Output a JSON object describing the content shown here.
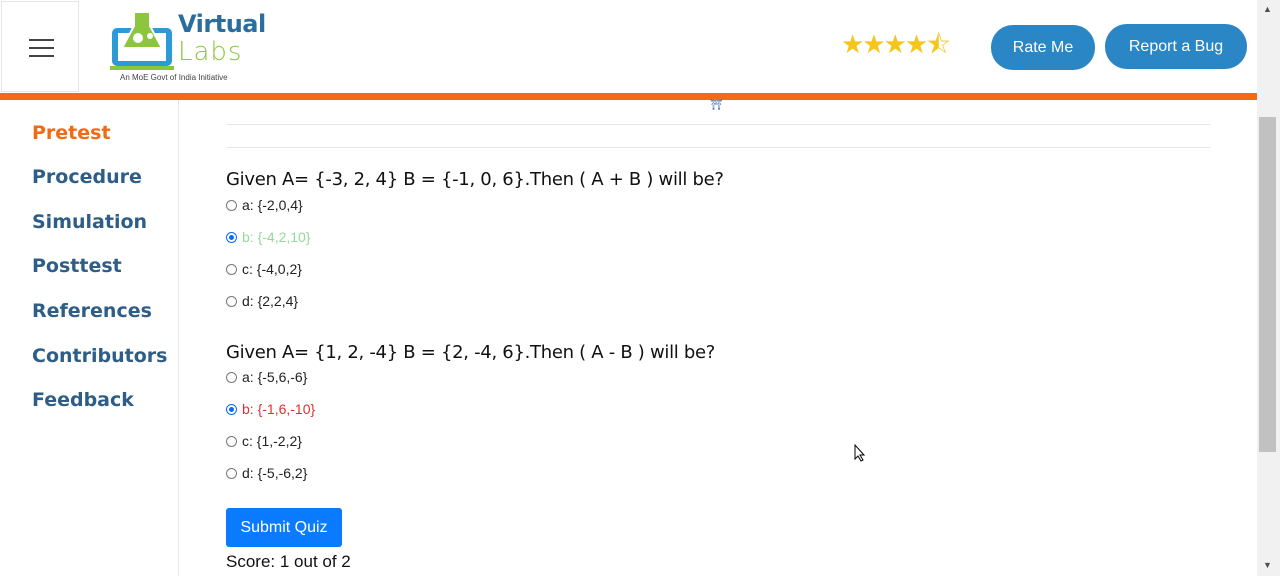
{
  "header": {
    "logo": {
      "virtual": "Virtual",
      "labs": "Labs",
      "tagline": "An MoE Govt of India Initiative"
    },
    "rating_stars": "★★★★⯪",
    "rate_button": "Rate Me",
    "bug_button": "Report a Bug"
  },
  "sidebar": {
    "items": [
      {
        "label": "Pretest",
        "active": true
      },
      {
        "label": "Procedure"
      },
      {
        "label": "Simulation"
      },
      {
        "label": "Posttest"
      },
      {
        "label": "References"
      },
      {
        "label": "Contributors"
      },
      {
        "label": "Feedback"
      }
    ]
  },
  "quiz": {
    "questions": [
      {
        "text": "Given A= {-3, 2, 4} B = {-1, 0, 6}.Then ( A + B ) will be?",
        "options": [
          {
            "label": "a: {-2,0,4}"
          },
          {
            "label": "b: {-4,2,10}",
            "selected": true,
            "status": "correct"
          },
          {
            "label": "c: {-4,0,2}"
          },
          {
            "label": "d: {2,2,4}"
          }
        ]
      },
      {
        "text": "Given A= {1, 2, -4} B = {2, -4, 6}.Then ( A - B ) will be?",
        "options": [
          {
            "label": "a: {-5,6,-6}"
          },
          {
            "label": "b: {-1,6,-10}",
            "selected": true,
            "status": "incorrect"
          },
          {
            "label": "c: {1,-2,2}"
          },
          {
            "label": "d: {-5,-6,2}"
          }
        ]
      }
    ],
    "submit_label": "Submit Quiz",
    "score": "Score: 1 out of 2"
  },
  "colors": {
    "accent": "#f26a14",
    "nav": "#2e5d87",
    "button": "#2a86c4",
    "submit": "#0a7bff"
  }
}
